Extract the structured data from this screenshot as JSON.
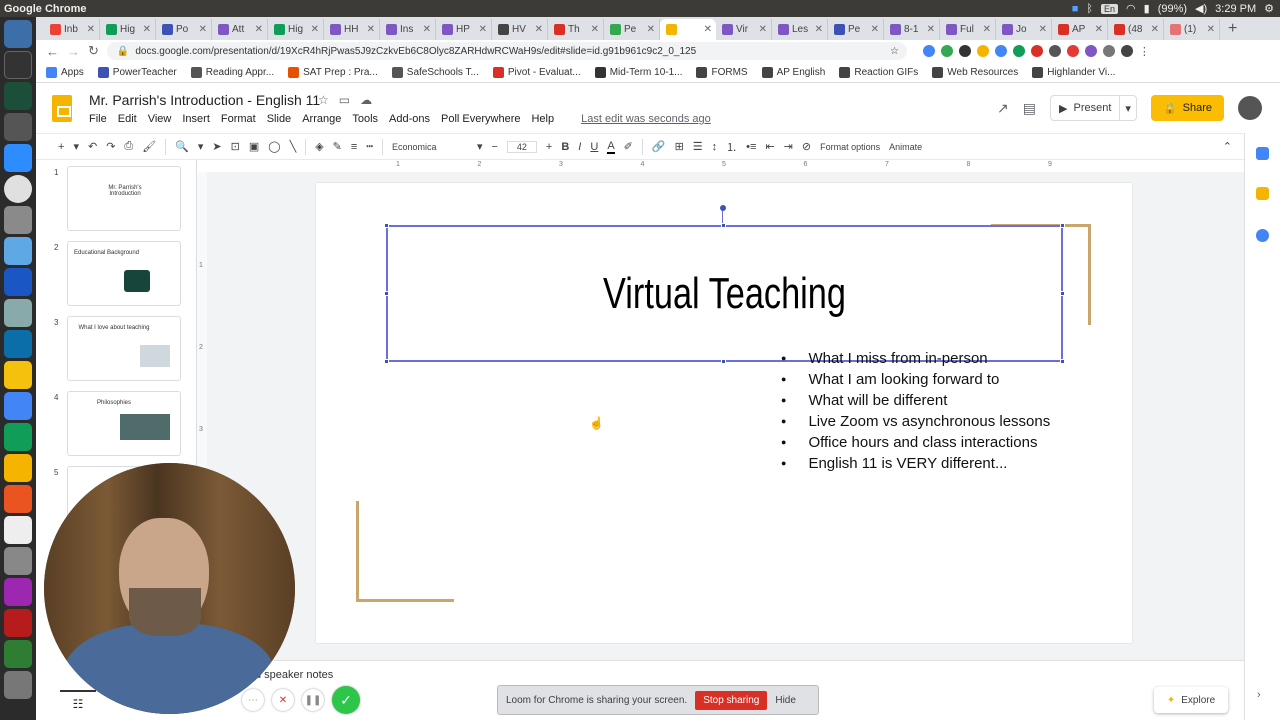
{
  "os": {
    "app_name": "Google Chrome",
    "battery": "(99%)",
    "lang": "En",
    "time": "3:29 PM"
  },
  "tabs": [
    {
      "label": "Inb",
      "color": "#ea4335"
    },
    {
      "label": "Hig",
      "color": "#0f9d58"
    },
    {
      "label": "Po",
      "color": "#3f51b5"
    },
    {
      "label": "Att",
      "color": "#7e57c2"
    },
    {
      "label": "Hig",
      "color": "#0f9d58"
    },
    {
      "label": "HH",
      "color": "#7e57c2"
    },
    {
      "label": "Ins",
      "color": "#7e57c2"
    },
    {
      "label": "HP",
      "color": "#7e57c2"
    },
    {
      "label": "HV",
      "color": "#444"
    },
    {
      "label": "Th",
      "color": "#d93025"
    },
    {
      "label": "Pe",
      "color": "#34a853"
    },
    {
      "label": "",
      "color": "#f4b400",
      "active": true
    },
    {
      "label": "Vir",
      "color": "#7e57c2"
    },
    {
      "label": "Les",
      "color": "#7e57c2"
    },
    {
      "label": "Pe",
      "color": "#3f51b5"
    },
    {
      "label": "8-1",
      "color": "#7e57c2"
    },
    {
      "label": "Ful",
      "color": "#7e57c2"
    },
    {
      "label": "Jo",
      "color": "#7e57c2"
    },
    {
      "label": "AP",
      "color": "#d93025"
    },
    {
      "label": "(48",
      "color": "#d93025"
    },
    {
      "label": "(1)",
      "color": "#e57373"
    }
  ],
  "omnibox": {
    "url": "docs.google.com/presentation/d/19XcR4hRjPwas5J9zCzkvEb6C8Olyc8ZARHdwRCWaH9s/edit#slide=id.g91b961c9c2_0_125"
  },
  "bookmarks": [
    {
      "label": "Apps",
      "color": "#4285f4"
    },
    {
      "label": "PowerTeacher",
      "color": "#3f51b5"
    },
    {
      "label": "Reading Appr...",
      "color": "#555"
    },
    {
      "label": "SAT Prep : Pra...",
      "color": "#e65100"
    },
    {
      "label": "SafeSchools T...",
      "color": "#555"
    },
    {
      "label": "Pivot - Evaluat...",
      "color": "#d93025"
    },
    {
      "label": "Mid-Term 10-1...",
      "color": "#333"
    },
    {
      "label": "FORMS",
      "color": "#444"
    },
    {
      "label": "AP English",
      "color": "#444"
    },
    {
      "label": "Reaction GIFs",
      "color": "#444"
    },
    {
      "label": "Web Resources",
      "color": "#444"
    },
    {
      "label": "Highlander Vi...",
      "color": "#444"
    }
  ],
  "doc": {
    "title": "Mr. Parrish's Introduction - English 11",
    "menu": [
      "File",
      "Edit",
      "View",
      "Insert",
      "Format",
      "Slide",
      "Arrange",
      "Tools",
      "Add-ons",
      "Poll Everywhere",
      "Help"
    ],
    "last_edit": "Last edit was seconds ago",
    "present_label": "Present",
    "share_label": "Share"
  },
  "toolbar": {
    "font": "Economica",
    "font_size": "42",
    "format_options": "Format options",
    "animate": "Animate"
  },
  "ruler": {
    "h": [
      "1",
      "2",
      "3",
      "4",
      "5",
      "6",
      "7",
      "8",
      "9"
    ],
    "v": [
      "1",
      "2",
      "3"
    ]
  },
  "slides": [
    {
      "num": "1",
      "text": "Mr. Parrish's Introduction"
    },
    {
      "num": "2",
      "text": "Educational Background"
    },
    {
      "num": "3",
      "text": "What I love about teaching"
    },
    {
      "num": "4",
      "text": "Philosophies"
    },
    {
      "num": "5",
      "text": ""
    }
  ],
  "current_slide": {
    "title": "Virtual Teaching",
    "bullets": [
      "What I miss from in-person",
      "What I am looking forward to",
      "What will be different",
      "Live Zoom vs asynchronous lessons",
      "Office hours and class interactions",
      "English 11 is VERY different..."
    ]
  },
  "notes": {
    "placeholder": "d speaker notes"
  },
  "loom": {
    "message": "Loom for Chrome is sharing your screen.",
    "stop_label": "Stop sharing",
    "hide_label": "Hide"
  },
  "explore_label": "Explore"
}
